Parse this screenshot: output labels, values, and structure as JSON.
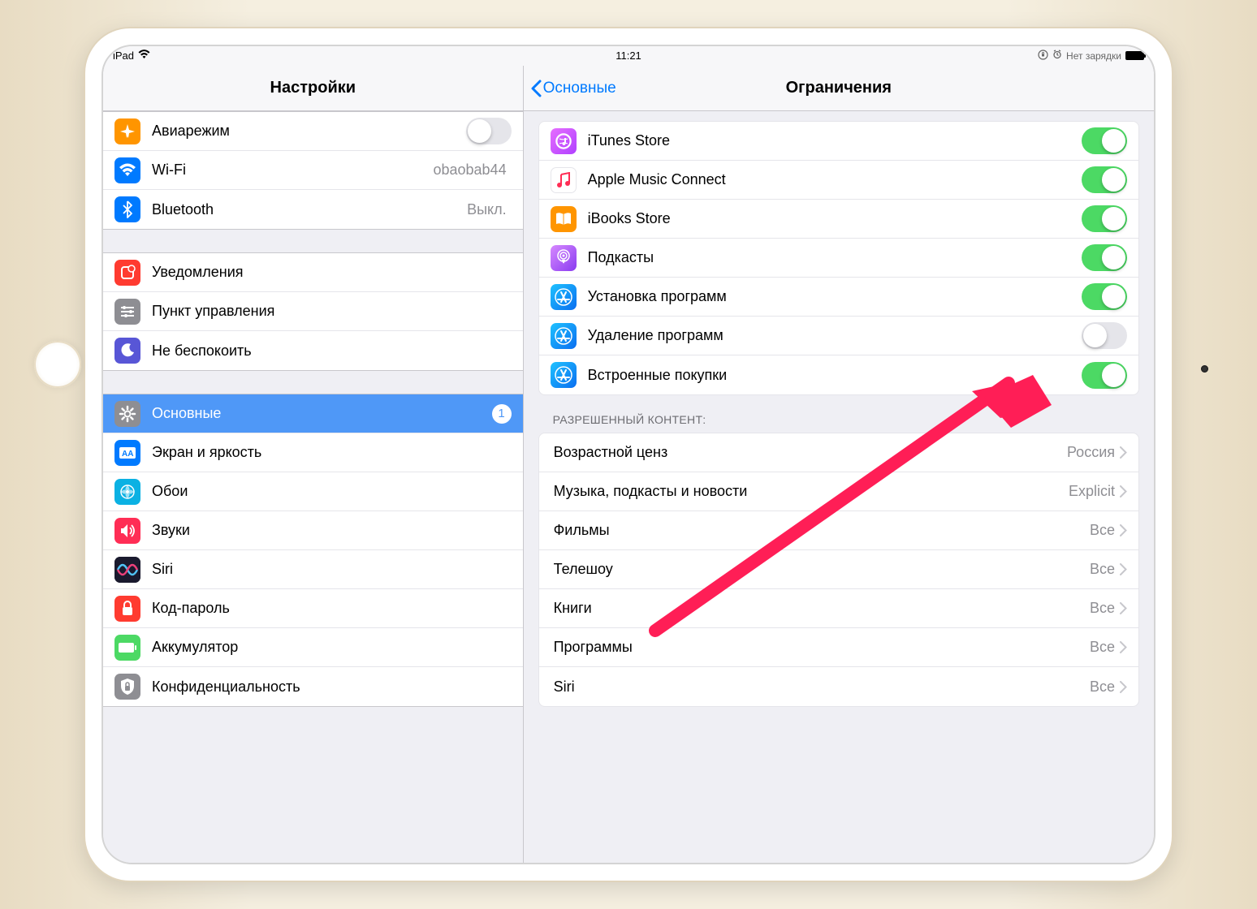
{
  "statusbar": {
    "device": "iPad",
    "time": "11:21",
    "battery": "Нет зарядки"
  },
  "left": {
    "title": "Настройки",
    "group1": [
      {
        "icon": "airplane",
        "label": "Авиарежим",
        "toggle": false
      },
      {
        "icon": "wifi",
        "label": "Wi-Fi",
        "value": "obaobab44"
      },
      {
        "icon": "bluetooth",
        "label": "Bluetooth",
        "value": "Выкл."
      }
    ],
    "group2": [
      {
        "icon": "notifications",
        "label": "Уведомления"
      },
      {
        "icon": "controlcenter",
        "label": "Пункт управления"
      },
      {
        "icon": "dnd",
        "label": "Не беспокоить"
      }
    ],
    "group3": [
      {
        "icon": "general",
        "label": "Основные",
        "selected": true,
        "badge": "1"
      },
      {
        "icon": "display",
        "label": "Экран и яркость"
      },
      {
        "icon": "wallpaper",
        "label": "Обои"
      },
      {
        "icon": "sounds",
        "label": "Звуки"
      },
      {
        "icon": "siri",
        "label": "Siri"
      },
      {
        "icon": "passcode",
        "label": "Код-пароль"
      },
      {
        "icon": "battery",
        "label": "Аккумулятор"
      },
      {
        "icon": "privacy",
        "label": "Конфиденциальность"
      }
    ]
  },
  "right": {
    "back": "Основные",
    "title": "Ограничения",
    "toggles": [
      {
        "icon": "itunes",
        "label": "iTunes Store",
        "on": true
      },
      {
        "icon": "music",
        "label": "Apple Music Connect",
        "on": true
      },
      {
        "icon": "ibooks",
        "label": "iBooks Store",
        "on": true
      },
      {
        "icon": "podcast",
        "label": "Подкасты",
        "on": true
      },
      {
        "icon": "appstore",
        "label": "Установка программ",
        "on": true
      },
      {
        "icon": "appstore",
        "label": "Удаление программ",
        "on": false
      },
      {
        "icon": "appstore",
        "label": "Встроенные покупки",
        "on": true
      }
    ],
    "contentHeader": "РАЗРЕШЕННЫЙ КОНТЕНТ:",
    "content": [
      {
        "label": "Возрастной ценз",
        "value": "Россия"
      },
      {
        "label": "Музыка, подкасты и новости",
        "value": "Explicit"
      },
      {
        "label": "Фильмы",
        "value": "Все"
      },
      {
        "label": "Телешоу",
        "value": "Все"
      },
      {
        "label": "Книги",
        "value": "Все"
      },
      {
        "label": "Программы",
        "value": "Все"
      },
      {
        "label": "Siri",
        "value": "Все"
      }
    ]
  }
}
